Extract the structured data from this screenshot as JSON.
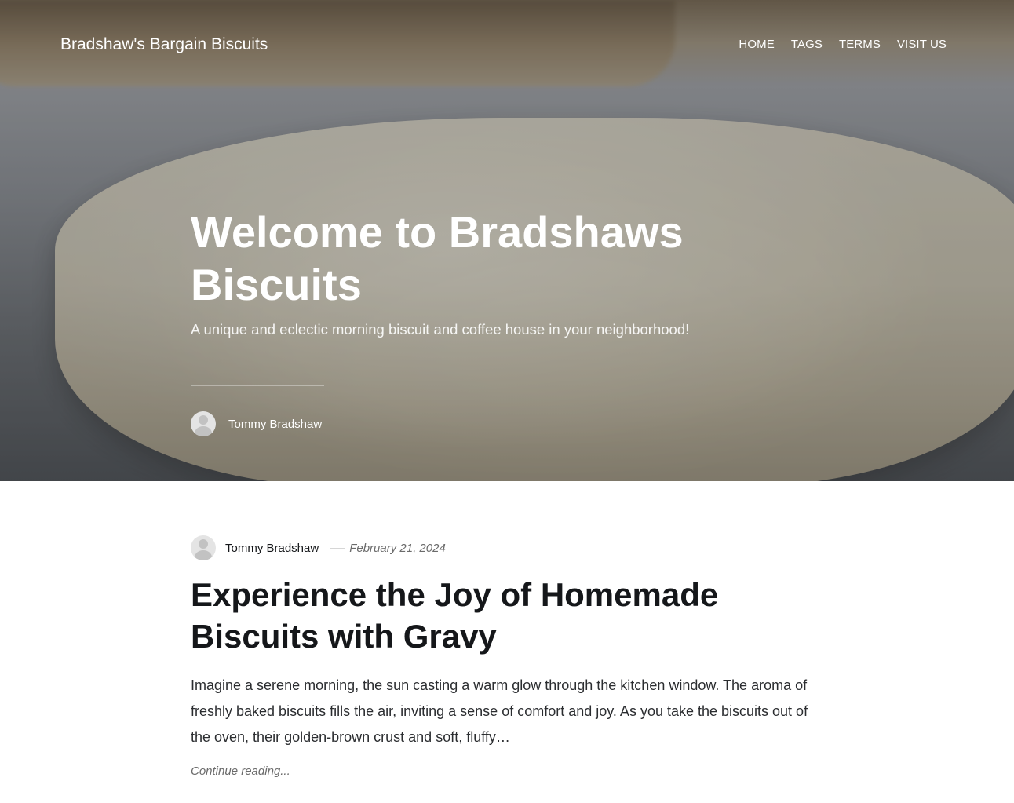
{
  "site": {
    "title": "Bradshaw's Bargain Biscuits"
  },
  "nav": {
    "items": [
      "HOME",
      "TAGS",
      "TERMS",
      "VISIT US"
    ]
  },
  "hero": {
    "title": "Welcome to Bradshaws Biscuits",
    "subtitle": "A unique and eclectic morning biscuit and coffee house in your neighborhood!",
    "author": "Tommy Bradshaw"
  },
  "post": {
    "author": "Tommy Bradshaw",
    "date": "February 21, 2024",
    "title": "Experience the Joy of Homemade Biscuits with Gravy",
    "excerpt": "Imagine a serene morning, the sun casting a warm glow through the kitchen window. The aroma of freshly baked biscuits fills the air, inviting a sense of comfort and joy. As you take the biscuits out of the oven, their golden-brown crust and soft, fluffy…",
    "continue_label": "Continue reading..."
  }
}
